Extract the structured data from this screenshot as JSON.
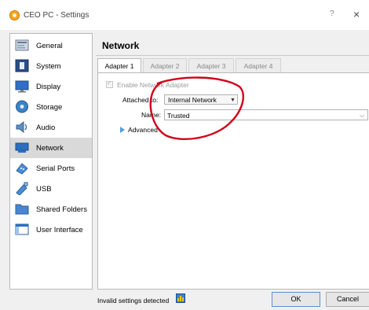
{
  "window": {
    "title": "CEO PC - Settings",
    "help": "?",
    "close": "×"
  },
  "sidebar": {
    "items": [
      {
        "label": "General",
        "icon": "general-icon",
        "active": false
      },
      {
        "label": "System",
        "icon": "system-icon",
        "active": false
      },
      {
        "label": "Display",
        "icon": "display-icon",
        "active": false
      },
      {
        "label": "Storage",
        "icon": "storage-icon",
        "active": false
      },
      {
        "label": "Audio",
        "icon": "audio-icon",
        "active": false
      },
      {
        "label": "Network",
        "icon": "network-icon",
        "active": true
      },
      {
        "label": "Serial Ports",
        "icon": "serial-ports-icon",
        "active": false
      },
      {
        "label": "USB",
        "icon": "usb-icon",
        "active": false
      },
      {
        "label": "Shared Folders",
        "icon": "shared-folders-icon",
        "active": false
      },
      {
        "label": "User Interface",
        "icon": "user-interface-icon",
        "active": false
      }
    ]
  },
  "main": {
    "title": "Network",
    "tabs": [
      {
        "label": "Adapter 1",
        "active": true
      },
      {
        "label": "Adapter 2",
        "active": false
      },
      {
        "label": "Adapter 3",
        "active": false
      },
      {
        "label": "Adapter 4",
        "active": false
      }
    ],
    "enable_adapter": {
      "label": "Enable Network Adapter",
      "checked": true,
      "enabled": false
    },
    "attached_to": {
      "label": "Attached to:",
      "value": "Internal Network"
    },
    "name": {
      "label": "Name:",
      "value": "Trusted"
    },
    "advanced": {
      "label": "Advanced"
    }
  },
  "footer": {
    "status": "Invalid settings detected",
    "ok_label": "OK",
    "cancel_label": "Cancel"
  },
  "colors": {
    "annotation": "#d0021b",
    "active_item": "#d9d9d9",
    "accent": "#4f9fe0"
  }
}
